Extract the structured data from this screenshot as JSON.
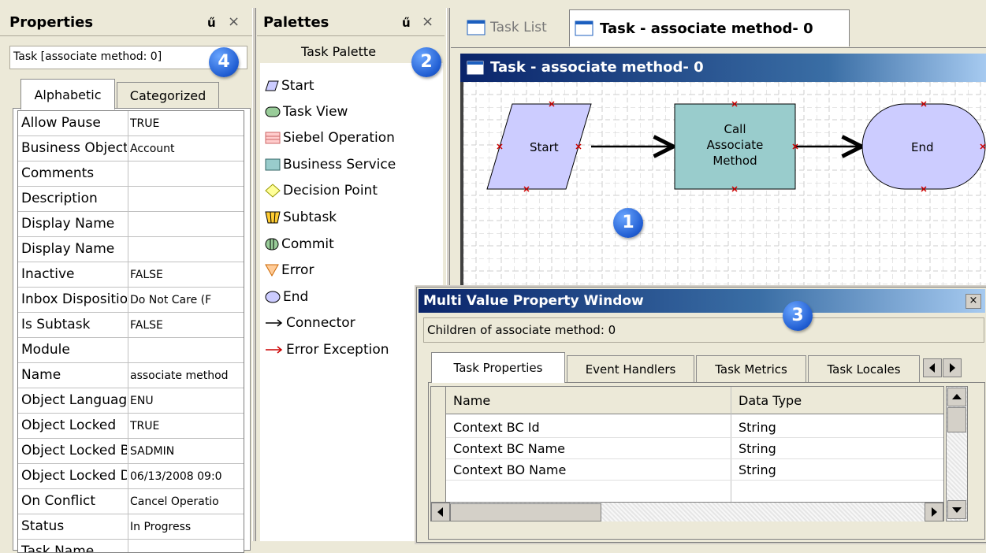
{
  "properties": {
    "title": "Properties",
    "pin": "ű",
    "close": "×",
    "object_label": "Task [associate method: 0]",
    "tabs": [
      "Alphabetic",
      "Categorized"
    ],
    "rows": [
      {
        "name": "Allow Pause",
        "value": "TRUE"
      },
      {
        "name": "Business Object",
        "value": "Account"
      },
      {
        "name": "Comments",
        "value": ""
      },
      {
        "name": "Description",
        "value": ""
      },
      {
        "name": "Display Name",
        "value": ""
      },
      {
        "name": "Display Name",
        "value": ""
      },
      {
        "name": "Inactive",
        "value": "FALSE"
      },
      {
        "name": "Inbox Disposition",
        "value": "Do Not Care (F"
      },
      {
        "name": "Is Subtask",
        "value": "FALSE"
      },
      {
        "name": "Module",
        "value": ""
      },
      {
        "name": "Name",
        "value": "associate method"
      },
      {
        "name": "Object Language",
        "value": "ENU"
      },
      {
        "name": "Object Locked",
        "value": "TRUE"
      },
      {
        "name": "Object Locked By",
        "value": "SADMIN"
      },
      {
        "name": "Object Locked Date",
        "value": "06/13/2008 09:0"
      },
      {
        "name": "On Conflict",
        "value": "Cancel Operatio"
      },
      {
        "name": "Status",
        "value": "In Progress"
      },
      {
        "name": "Task Name",
        "value": ""
      }
    ]
  },
  "palettes": {
    "title": "Palettes",
    "pin": "ű",
    "close": "×",
    "subtitle": "Task Palette",
    "items": [
      {
        "label": "Start",
        "icon": "parallelogram-icon"
      },
      {
        "label": "Task View",
        "icon": "task-view-icon"
      },
      {
        "label": "Siebel Operation",
        "icon": "siebel-operation-icon"
      },
      {
        "label": "Business Service",
        "icon": "business-service-icon"
      },
      {
        "label": "Decision Point",
        "icon": "diamond-icon"
      },
      {
        "label": "Subtask",
        "icon": "subtask-icon"
      },
      {
        "label": "Commit",
        "icon": "commit-icon"
      },
      {
        "label": "Error",
        "icon": "triangle-icon"
      },
      {
        "label": "End",
        "icon": "oval-icon"
      },
      {
        "label": "Connector",
        "icon": "arrow-icon"
      },
      {
        "label": "Error Exception",
        "icon": "red-arrow-icon"
      }
    ]
  },
  "editor": {
    "tabs": [
      "Task List",
      "Task - associate method- 0"
    ],
    "window_title": "Task - associate method- 0",
    "nodes": {
      "start": "Start",
      "call_l1": "Call",
      "call_l2": "Associate",
      "call_l3": "Method",
      "end": "End"
    }
  },
  "badges": [
    "1",
    "2",
    "3",
    "4"
  ],
  "mvwindow": {
    "title": "Multi Value Property Window",
    "close": "×",
    "subtitle": "Children of associate method: 0",
    "tabs": [
      "Task Properties",
      "Event Handlers",
      "Task Metrics",
      "Task Locales"
    ],
    "columns": [
      "Name",
      "Data Type"
    ],
    "rows": [
      {
        "name": "Context BC Id",
        "type": "String"
      },
      {
        "name": "Context BC Name",
        "type": "String"
      },
      {
        "name": "Context BO Name",
        "type": "String"
      }
    ]
  },
  "colors": {
    "title_bar": "#0a246a",
    "title_bar_end": "#a6caf0",
    "start_fill": "#ccccff",
    "call_fill": "#99cccc",
    "end_fill": "#ccccff"
  }
}
